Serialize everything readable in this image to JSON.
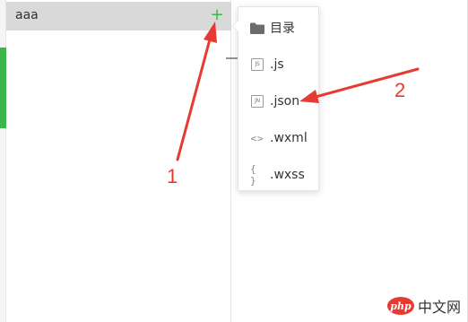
{
  "sidebar": {
    "folder_name": "aaa",
    "add_symbol": "+"
  },
  "menu": {
    "items": [
      {
        "label": "目录",
        "icon": "folder-icon"
      },
      {
        "label": ".js",
        "icon": "js-file-icon",
        "icon_text": "JS"
      },
      {
        "label": ".json",
        "icon": "json-file-icon",
        "icon_text": "JN"
      },
      {
        "label": ".wxml",
        "icon": "wxml-file-icon",
        "icon_text": "<>"
      },
      {
        "label": ".wxss",
        "icon": "wxss-file-icon",
        "icon_text": "{ }"
      }
    ]
  },
  "annotations": {
    "label_1": "1",
    "label_2": "2",
    "color": "#e53b33"
  },
  "watermark": {
    "logo_text": "php",
    "site_text": "中文网"
  },
  "colors": {
    "accent_green": "#3cb54a",
    "annotation_red": "#e53b33"
  }
}
